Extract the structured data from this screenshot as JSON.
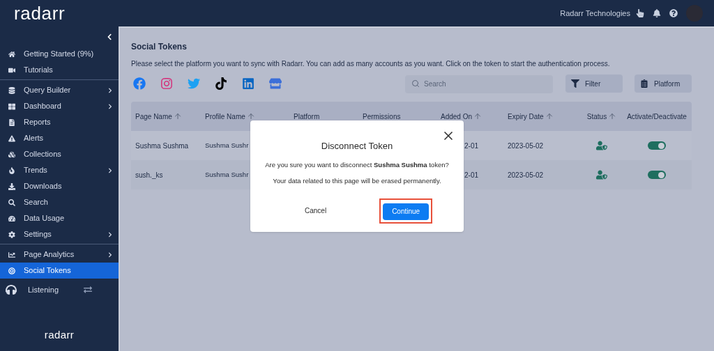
{
  "header": {
    "logo": "radarr",
    "org": "Radarr Technologies"
  },
  "sidebar": {
    "sections": [
      [
        {
          "label": "Getting Started (9%)",
          "submenu": false,
          "selected": false
        },
        {
          "label": "Tutorials",
          "submenu": false,
          "selected": false
        }
      ],
      [
        {
          "label": "Query Builder",
          "submenu": true,
          "selected": false
        },
        {
          "label": "Dashboard",
          "submenu": true,
          "selected": false
        },
        {
          "label": "Reports",
          "submenu": false,
          "selected": false
        },
        {
          "label": "Alerts",
          "submenu": false,
          "selected": false
        },
        {
          "label": "Collections",
          "submenu": false,
          "selected": false
        },
        {
          "label": "Trends",
          "submenu": true,
          "selected": false
        },
        {
          "label": "Downloads",
          "submenu": false,
          "selected": false
        },
        {
          "label": "Search",
          "submenu": false,
          "selected": false
        },
        {
          "label": "Data Usage",
          "submenu": false,
          "selected": false
        },
        {
          "label": "Settings",
          "submenu": true,
          "selected": false
        }
      ],
      [
        {
          "label": "Page Analytics",
          "submenu": true,
          "selected": false
        },
        {
          "label": "Social Tokens",
          "submenu": false,
          "selected": true
        }
      ]
    ],
    "listening": "Listening",
    "footer_logo": "radarr"
  },
  "page": {
    "title": "Social Tokens",
    "description": "Please select the platform you want to sync with Radarr. You can add as many accounts as you want. Click on the token to start the authentication process.",
    "search": {
      "placeholder": "Search"
    },
    "filter_button": "Filter",
    "platform_button": "Platform"
  },
  "table": {
    "columns": [
      {
        "label": "Page Name",
        "sortable": true
      },
      {
        "label": "Profile Name",
        "sortable": true
      },
      {
        "label": "Platform",
        "sortable": false
      },
      {
        "label": "Permissions",
        "sortable": false
      },
      {
        "label": "Added On",
        "sortable": true
      },
      {
        "label": "Expiry Date",
        "sortable": true
      },
      {
        "label": "Status",
        "sortable": true
      },
      {
        "label": "Activate/Deactivate",
        "sortable": false
      }
    ],
    "rows": [
      {
        "page_name": "Sushma Sushma",
        "profile_name": "Sushma Sushr",
        "added_on": "2-01",
        "expiry_date": "2023-05-02",
        "verified": true,
        "active": true
      },
      {
        "page_name": "sush._ks",
        "profile_name": "Sushma Sushr",
        "added_on": "2-01",
        "expiry_date": "2023-05-02",
        "verified": true,
        "active": true
      }
    ]
  },
  "dialog": {
    "title": "Disconnect Token",
    "message": "Are you sure you want to disconnect **Sushma Sushma** token?",
    "note": "Your data related to this page will be erased permanently.",
    "cancel": "Cancel",
    "confirm": "Continue",
    "confirm_highlighted": true
  }
}
